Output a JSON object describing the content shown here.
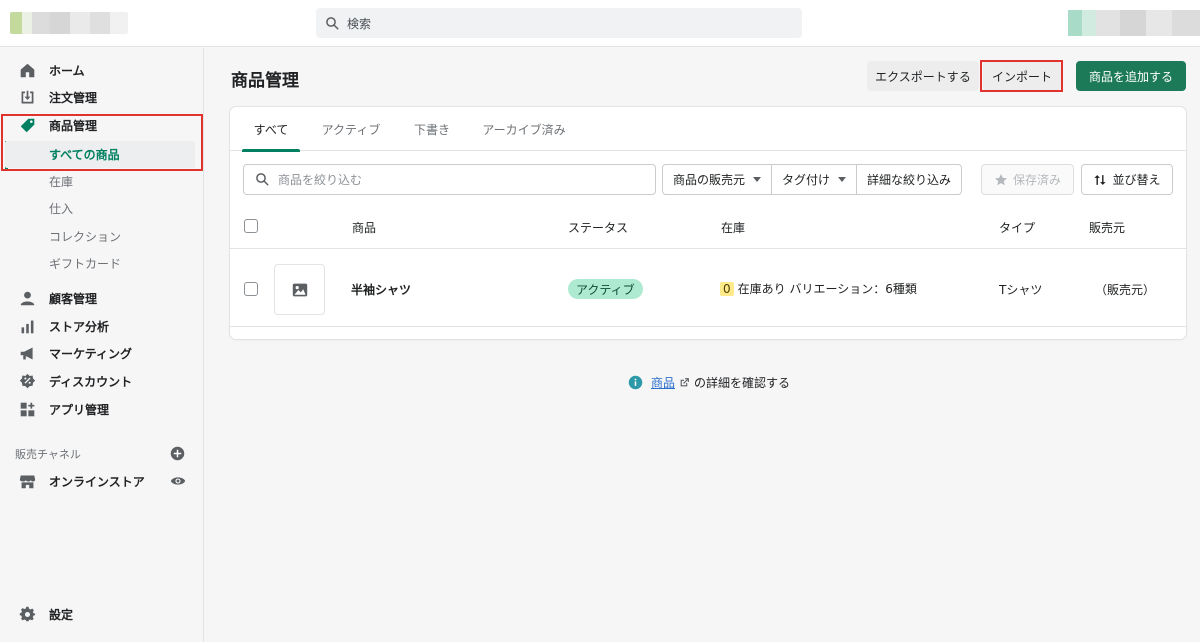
{
  "header": {
    "search_placeholder": "検索"
  },
  "sidebar": {
    "items": [
      {
        "label": "ホーム"
      },
      {
        "label": "注文管理"
      },
      {
        "label": "商品管理"
      }
    ],
    "product_sub": [
      {
        "label": "すべての商品",
        "active": true
      },
      {
        "label": "在庫"
      },
      {
        "label": "仕入"
      },
      {
        "label": "コレクション"
      },
      {
        "label": "ギフトカード"
      }
    ],
    "items2": [
      {
        "label": "顧客管理"
      },
      {
        "label": "ストア分析"
      },
      {
        "label": "マーケティング"
      },
      {
        "label": "ディスカウント"
      },
      {
        "label": "アプリ管理"
      }
    ],
    "channels_label": "販売チャネル",
    "online_store": "オンラインストア",
    "settings": "設定"
  },
  "page": {
    "title": "商品管理",
    "export_label": "エクスポートする",
    "import_label": "インポート",
    "add_label": "商品を追加する"
  },
  "tabs": [
    {
      "label": "すべて",
      "active": true
    },
    {
      "label": "アクティブ"
    },
    {
      "label": "下書き"
    },
    {
      "label": "アーカイブ済み"
    }
  ],
  "filters": {
    "search_placeholder": "商品を絞り込む",
    "vendor": "商品の販売元",
    "tagged": "タグ付け",
    "more": "詳細な絞り込み",
    "saved": "保存済み",
    "sort": "並び替え"
  },
  "table": {
    "headers": [
      "商品",
      "ステータス",
      "在庫",
      "タイプ",
      "販売元"
    ],
    "rows": [
      {
        "name": "半袖シャツ",
        "status": "アクティブ",
        "stock_count": "0",
        "stock_text": "在庫あり バリエーション：6種類",
        "type": "Tシャツ",
        "vendor": "（販売元）"
      }
    ]
  },
  "help": {
    "link": "商品",
    "suffix": "の詳細を確認する"
  },
  "colors": {
    "primary": "#1c7a58",
    "accent": "#008060",
    "highlight_box": "#e0332e",
    "badge_bg": "#aee9d1",
    "link": "#2c6ecb"
  }
}
